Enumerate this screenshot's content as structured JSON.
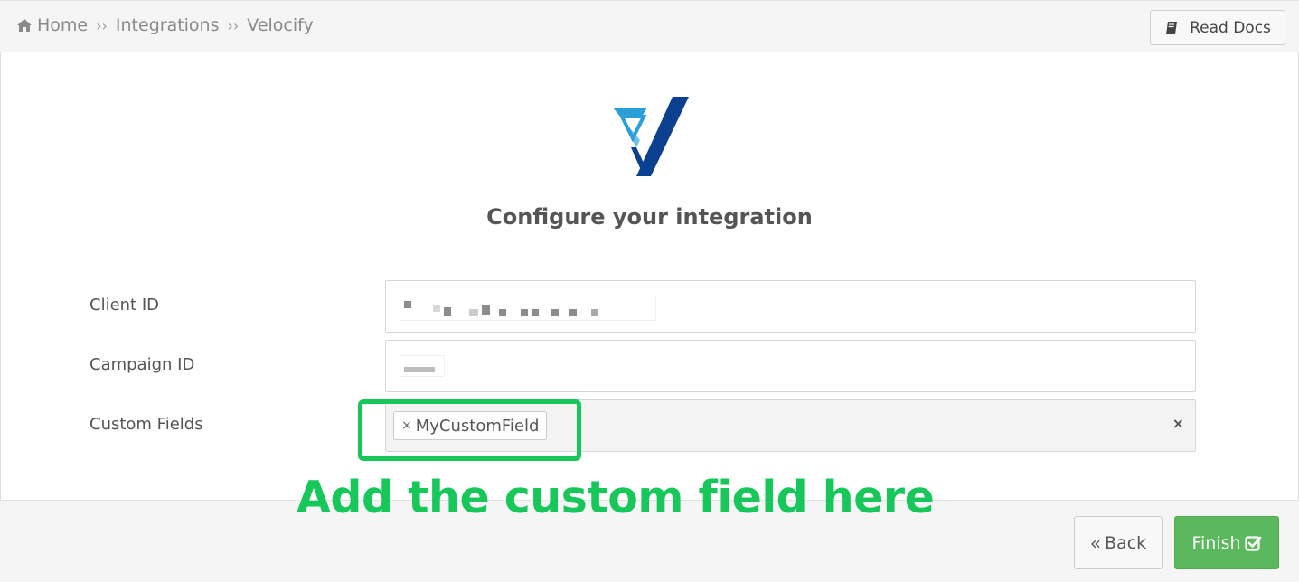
{
  "breadcrumb": {
    "home_icon": "home-icon",
    "items": [
      "Home",
      "Integrations",
      "Velocify"
    ],
    "separator": "››"
  },
  "header": {
    "read_docs_label": "Read Docs",
    "read_docs_icon": "book-icon"
  },
  "logo": {
    "name": "velocify-logo",
    "colors": {
      "light": "#2a9fd8",
      "dark": "#0b3f8f"
    }
  },
  "title": "Configure your integration",
  "form": {
    "client_id_label": "Client ID",
    "campaign_id_label": "Campaign ID",
    "custom_fields_label": "Custom Fields",
    "custom_field_tags": [
      "MyCustomField"
    ],
    "tag_remove_glyph": "×",
    "clear_all_glyph": "×"
  },
  "annotation": {
    "text": "Add the custom field here",
    "color": "#17c75a"
  },
  "footer": {
    "back_label": "Back",
    "back_icon": "double-chevron-left-icon",
    "finish_label": "Finish",
    "finish_icon": "check-square-icon",
    "finish_color": "#5cb85c"
  }
}
